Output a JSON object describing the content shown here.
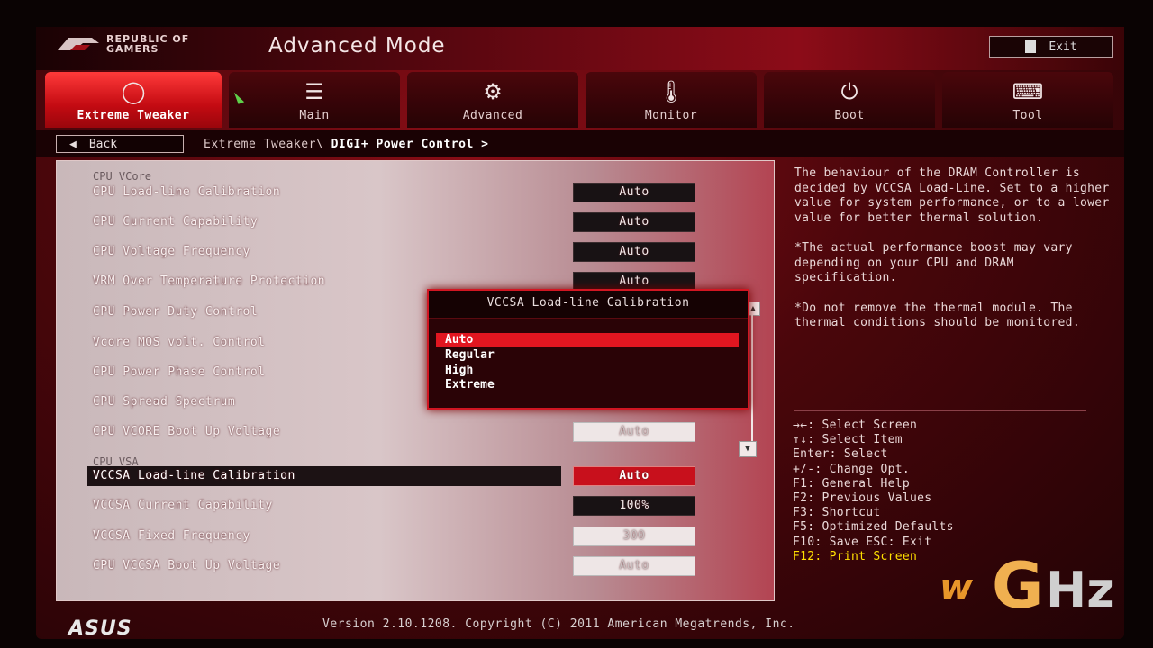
{
  "header": {
    "logo_text_line1": "REPUBLIC OF",
    "logo_text_line2": "GAMERS",
    "mode_title": "Advanced Mode",
    "exit_label": "Exit"
  },
  "tabs": [
    {
      "label": "Extreme Tweaker",
      "icon": "tweaker-icon",
      "glyph": "◯",
      "active": true
    },
    {
      "label": "Main",
      "icon": "list-icon",
      "glyph": "☰",
      "active": false
    },
    {
      "label": "Advanced",
      "icon": "advanced-icon",
      "glyph": "⚙",
      "active": false
    },
    {
      "label": "Monitor",
      "icon": "monitor-icon",
      "glyph": "🌡",
      "active": false
    },
    {
      "label": "Boot",
      "icon": "power-icon",
      "glyph": "⏻",
      "active": false
    },
    {
      "label": "Tool",
      "icon": "tool-icon",
      "glyph": "⌨",
      "active": false
    }
  ],
  "nav": {
    "back_label": "Back",
    "breadcrumb_prefix": "Extreme Tweaker\\",
    "breadcrumb_current": "DIGI+ Power Control >"
  },
  "settings": {
    "group_vcore": "CPU VCore",
    "group_vsa": "CPU VSA",
    "rows": [
      {
        "label": "CPU Load-line Calibration",
        "value": "Auto"
      },
      {
        "label": "CPU Current Capability",
        "value": "Auto"
      },
      {
        "label": "CPU Voltage Frequency",
        "value": "Auto"
      },
      {
        "label": "VRM Over Temperature Protection",
        "value": "Auto"
      },
      {
        "label": "CPU Power Duty Control",
        "value": ""
      },
      {
        "label": "Vcore MOS volt. Control",
        "value": ""
      },
      {
        "label": "CPU Power Phase Control",
        "value": ""
      },
      {
        "label": "CPU Spread Spectrum",
        "value": ""
      },
      {
        "label": "CPU VCORE Boot Up Voltage",
        "value": "Auto"
      },
      {
        "label": "VCCSA Load-line Calibration",
        "value": "Auto"
      },
      {
        "label": "VCCSA Current Capability",
        "value": "100%"
      },
      {
        "label": "VCCSA Fixed Frequency",
        "value": "300"
      },
      {
        "label": "CPU VCCSA Boot Up Voltage",
        "value": "Auto"
      }
    ]
  },
  "popup": {
    "title": "VCCSA Load-line Calibration",
    "options": [
      "Auto",
      "Regular",
      "High",
      "Extreme"
    ],
    "selected": "Auto"
  },
  "help": {
    "p1": "The behaviour of the DRAM Controller is decided by VCCSA Load-Line. Set to a higher value for system performance, or to a lower value for better thermal solution.",
    "p2": "*The actual performance boost may vary depending on your CPU and DRAM specification.",
    "p3": "*Do not remove the thermal module. The thermal conditions should be monitored."
  },
  "keys": [
    "→←: Select Screen",
    "↑↓: Select Item",
    "Enter: Select",
    "+/-: Change Opt.",
    "F1: General Help",
    "F2: Previous Values",
    "F3: Shortcut",
    "F5: Optimized Defaults",
    "F10: Save  ESC: Exit",
    "F12: Print Screen"
  ],
  "footer": {
    "brand": "ASUS",
    "version": "Version 2.10.1208. Copyright (C) 2011 American Megatrends, Inc."
  },
  "watermark": {
    "w": "w",
    "g": "G",
    "hz": "Hz"
  }
}
